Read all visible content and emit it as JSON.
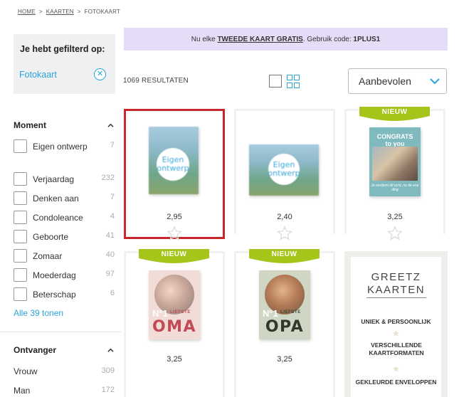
{
  "breadcrumb": {
    "home": "HOME",
    "sep1": ">",
    "kaarten": "KAARTEN",
    "sep2": ">",
    "current": "FOTOKAART"
  },
  "promo": {
    "pre": "Nu elke",
    "highlight": "TWEEDE KAART GRATIS",
    "mid": ". Gebruik code:",
    "code": "1PLUS1"
  },
  "filters": {
    "title": "Je hebt gefilterd op:",
    "active": "Fotokaart",
    "moment": {
      "heading": "Moment",
      "options": [
        {
          "label": "Eigen ontwerp",
          "count": "7"
        },
        {
          "label": "Verjaardag",
          "count": "232"
        },
        {
          "label": "Denken aan",
          "count": "7"
        },
        {
          "label": "Condoleance",
          "count": "4"
        },
        {
          "label": "Geboorte",
          "count": "41"
        },
        {
          "label": "Zomaar",
          "count": "40"
        },
        {
          "label": "Moederdag",
          "count": "97"
        },
        {
          "label": "Beterschap",
          "count": "6"
        }
      ],
      "show_all": "Alle 39 tonen"
    },
    "ontvanger": {
      "heading": "Ontvanger",
      "options": [
        {
          "label": "Vrouw",
          "count": "309"
        },
        {
          "label": "Man",
          "count": "172"
        }
      ]
    }
  },
  "toolbar": {
    "results": "1069 RESULTATEN",
    "sort_value": "Aanbevolen"
  },
  "products": [
    {
      "price": "2,95",
      "text": "Eigen ontwerp"
    },
    {
      "price": "2,40",
      "text": "Eigen ontwerp"
    },
    {
      "price": "3,25",
      "badge": "NIEUW",
      "title": "CONGRATS",
      "subtitle": "to you",
      "tagline": "Je verdient dit echt, nu de ene ding"
    },
    {
      "price": "3,25",
      "badge": "NIEUW",
      "no": "N°1",
      "small": "LIEFSTE",
      "big": "OMA"
    },
    {
      "price": "3,25",
      "badge": "NIEUW",
      "no": "N°1",
      "small": "LIEFSTE",
      "big": "OPA"
    }
  ],
  "greetz": {
    "logo_line1": "GREETZ",
    "logo_line2": "KAARTEN",
    "features": [
      "UNIEK & PERSOONLIJK",
      "VERSCHILLENDE KAARTFORMATEN",
      "GEKLEURDE ENVELOPPEN"
    ]
  },
  "colors": {
    "accent": "#2aa3d8",
    "ribbon": "#a6c51a",
    "selection": "#c4282c",
    "promo_bg": "#e6dcf7"
  }
}
